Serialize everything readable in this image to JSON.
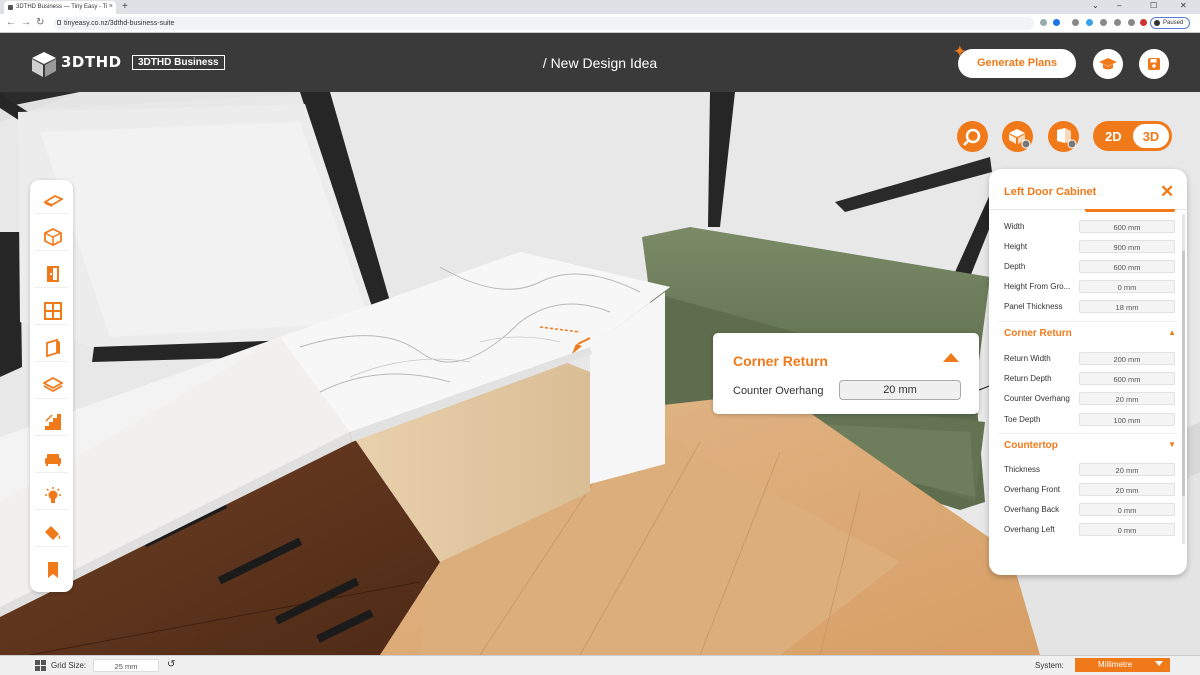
{
  "browser": {
    "tab_title": "3DTHD Business — Tiny Easy - Ti",
    "new_tab": "+",
    "url": "tinyeasy.co.nz/3dthd-business-suite",
    "profile_status": "Paused",
    "nav": {
      "back": "←",
      "forward": "→",
      "reload": "↻"
    },
    "window_controls": {
      "chevron": "⌄",
      "minimize": "–",
      "maximize": "☐",
      "close": "✕"
    }
  },
  "header": {
    "logo": "3DTHD",
    "badge": "3DTHD Business",
    "design_title": "/ New Design Idea",
    "generate_plans": "Generate Plans",
    "icons": [
      "graduation-cap-icon",
      "save-icon"
    ]
  },
  "view_controls": {
    "mode_2d": "2D",
    "mode_3d": "3D",
    "active_mode": "3D"
  },
  "left_toolbar": {
    "tools": [
      "floor-icon",
      "walls-icon",
      "doors-icon",
      "windows-icon",
      "panels-icon",
      "roof-icon",
      "stairs-icon",
      "furniture-icon",
      "lighting-icon",
      "paint-icon",
      "bookmark-icon"
    ]
  },
  "panel": {
    "title": "Left Door Cabinet",
    "close": "✕",
    "dimensions": [
      {
        "label": "Width",
        "value": "600 mm"
      },
      {
        "label": "Height",
        "value": "900 mm"
      },
      {
        "label": "Depth",
        "value": "600 mm"
      },
      {
        "label": "Height From Gro...",
        "value": "0 mm"
      },
      {
        "label": "Panel Thickness",
        "value": "18 mm"
      }
    ],
    "corner_return": {
      "title": "Corner Return",
      "arrow": "▲",
      "rows": [
        {
          "label": "Return Width",
          "value": "200 mm"
        },
        {
          "label": "Return Depth",
          "value": "600 mm"
        },
        {
          "label": "Counter Overhang",
          "value": "20 mm"
        },
        {
          "label": "Toe Depth",
          "value": "100 mm"
        }
      ]
    },
    "countertop": {
      "title": "Countertop",
      "arrow": "▼",
      "rows": [
        {
          "label": "Thickness",
          "value": "20 mm"
        },
        {
          "label": "Overhang Front",
          "value": "20 mm"
        },
        {
          "label": "Overhang Back",
          "value": "0 mm"
        },
        {
          "label": "Overhang Left",
          "value": "0 mm"
        }
      ]
    }
  },
  "callout": {
    "title": "Corner Return",
    "label": "Counter Overhang",
    "value": "20 mm"
  },
  "bottom_bar": {
    "grid_label": "Grid Size:",
    "grid_value": "25 mm",
    "system_label": "System:",
    "system_value": "Millimetre"
  },
  "colors": {
    "accent": "#f07a1a",
    "header_bg": "#3a3a3a"
  }
}
